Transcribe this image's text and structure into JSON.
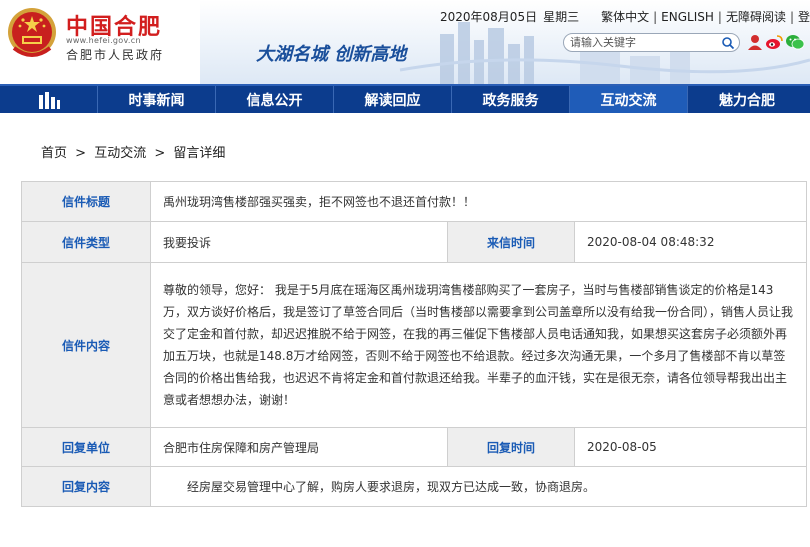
{
  "header": {
    "site_title": "中国合肥",
    "site_url": "www.hefei.gov.cn",
    "site_subtitle": "合肥市人民政府",
    "slogan": "大湖名城  创新高地",
    "date": "2020年08月05日",
    "weekday": "星期三",
    "links": [
      "繁体中文",
      "ENGLISH",
      "无障碍阅读",
      "登录"
    ],
    "search_placeholder": "请输入关键字",
    "colors": {
      "brand_red": "#d21e1e",
      "nav_blue": "#0c3c8d",
      "active_blue": "#1f5cb8",
      "label_blue": "#1a5bb5"
    }
  },
  "nav": {
    "home_icon": "city-skyline-icon",
    "items": [
      {
        "label": "时事新闻",
        "active": false
      },
      {
        "label": "信息公开",
        "active": false
      },
      {
        "label": "解读回应",
        "active": false
      },
      {
        "label": "政务服务",
        "active": false
      },
      {
        "label": "互动交流",
        "active": true
      },
      {
        "label": "魅力合肥",
        "active": false
      }
    ]
  },
  "breadcrumb": {
    "items": [
      "首页",
      "互动交流",
      "留言详细"
    ],
    "separator": ">"
  },
  "letter": {
    "title_label": "信件标题",
    "title": "禹州珑玥湾售楼部强买强卖，拒不网签也不退还首付款！！",
    "type_label": "信件类型",
    "type": "我要投诉",
    "received_label": "来信时间",
    "received": "2020-08-04 08:48:32",
    "content_label": "信件内容",
    "content": "尊敬的领导，您好：  我是于5月底在瑶海区禹州珑玥湾售楼部购买了一套房子，当时与售楼部销售谈定的价格是143万，双方谈好价格后，我是签订了草签合同后（当时售楼部以需要拿到公司盖章所以没有给我一份合同），销售人员让我交了定金和首付款，却迟迟推脱不给于网签，在我的再三催促下售楼部人员电话通知我，如果想买这套房子必须额外再加五万块，也就是148.8万才给网签，否则不给于网签也不给退款。经过多次沟通无果，一个多月了售楼部不肯以草签合同的价格出售给我，也迟迟不肯将定金和首付款退还给我。半辈子的血汗钱，实在是很无奈，请各位领导帮我出出主意或者想想办法，谢谢！",
    "reply_unit_label": "回复单位",
    "reply_unit": "合肥市住房保障和房产管理局",
    "reply_time_label": "回复时间",
    "reply_time": "2020-08-05",
    "reply_content_label": "回复内容",
    "reply_content": "经房屋交易管理中心了解，购房人要求退房，现双方已达成一致，协商退房。"
  }
}
